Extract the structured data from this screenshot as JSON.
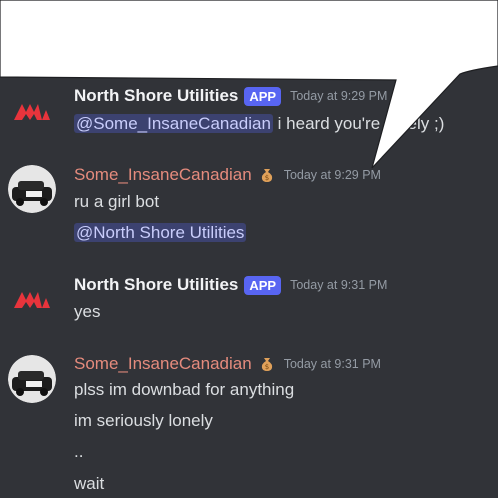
{
  "messages": [
    {
      "author": "North Shore Utilities",
      "badge": "APP",
      "timestamp": "Today at 9:29 PM",
      "mention": "@Some_InsaneCanadian",
      "text": " i heard you're lonely ;)"
    },
    {
      "author": "Some_InsaneCanadian",
      "timestamp": "Today at 9:29 PM",
      "lines": [
        "ru a girl bot"
      ],
      "mention": "@North Shore Utilities"
    },
    {
      "author": "North Shore Utilities",
      "badge": "APP",
      "timestamp": "Today at 9:31 PM",
      "lines": [
        "yes"
      ]
    },
    {
      "author": "Some_InsaneCanadian",
      "timestamp": "Today at 9:31 PM",
      "lines": [
        "plss im downbad for anything",
        "im seriously lonely",
        "..",
        "wait"
      ]
    }
  ],
  "colors": {
    "background": "#313338",
    "bot_name": "#f2f3f5",
    "user_name": "#e58b7d",
    "app_badge": "#5865f2",
    "mention_bg": "#3c4270",
    "timestamp": "#949ba4"
  },
  "icons": [
    "bot-logo-icon",
    "user-car-avatar",
    "money-bag-icon"
  ]
}
